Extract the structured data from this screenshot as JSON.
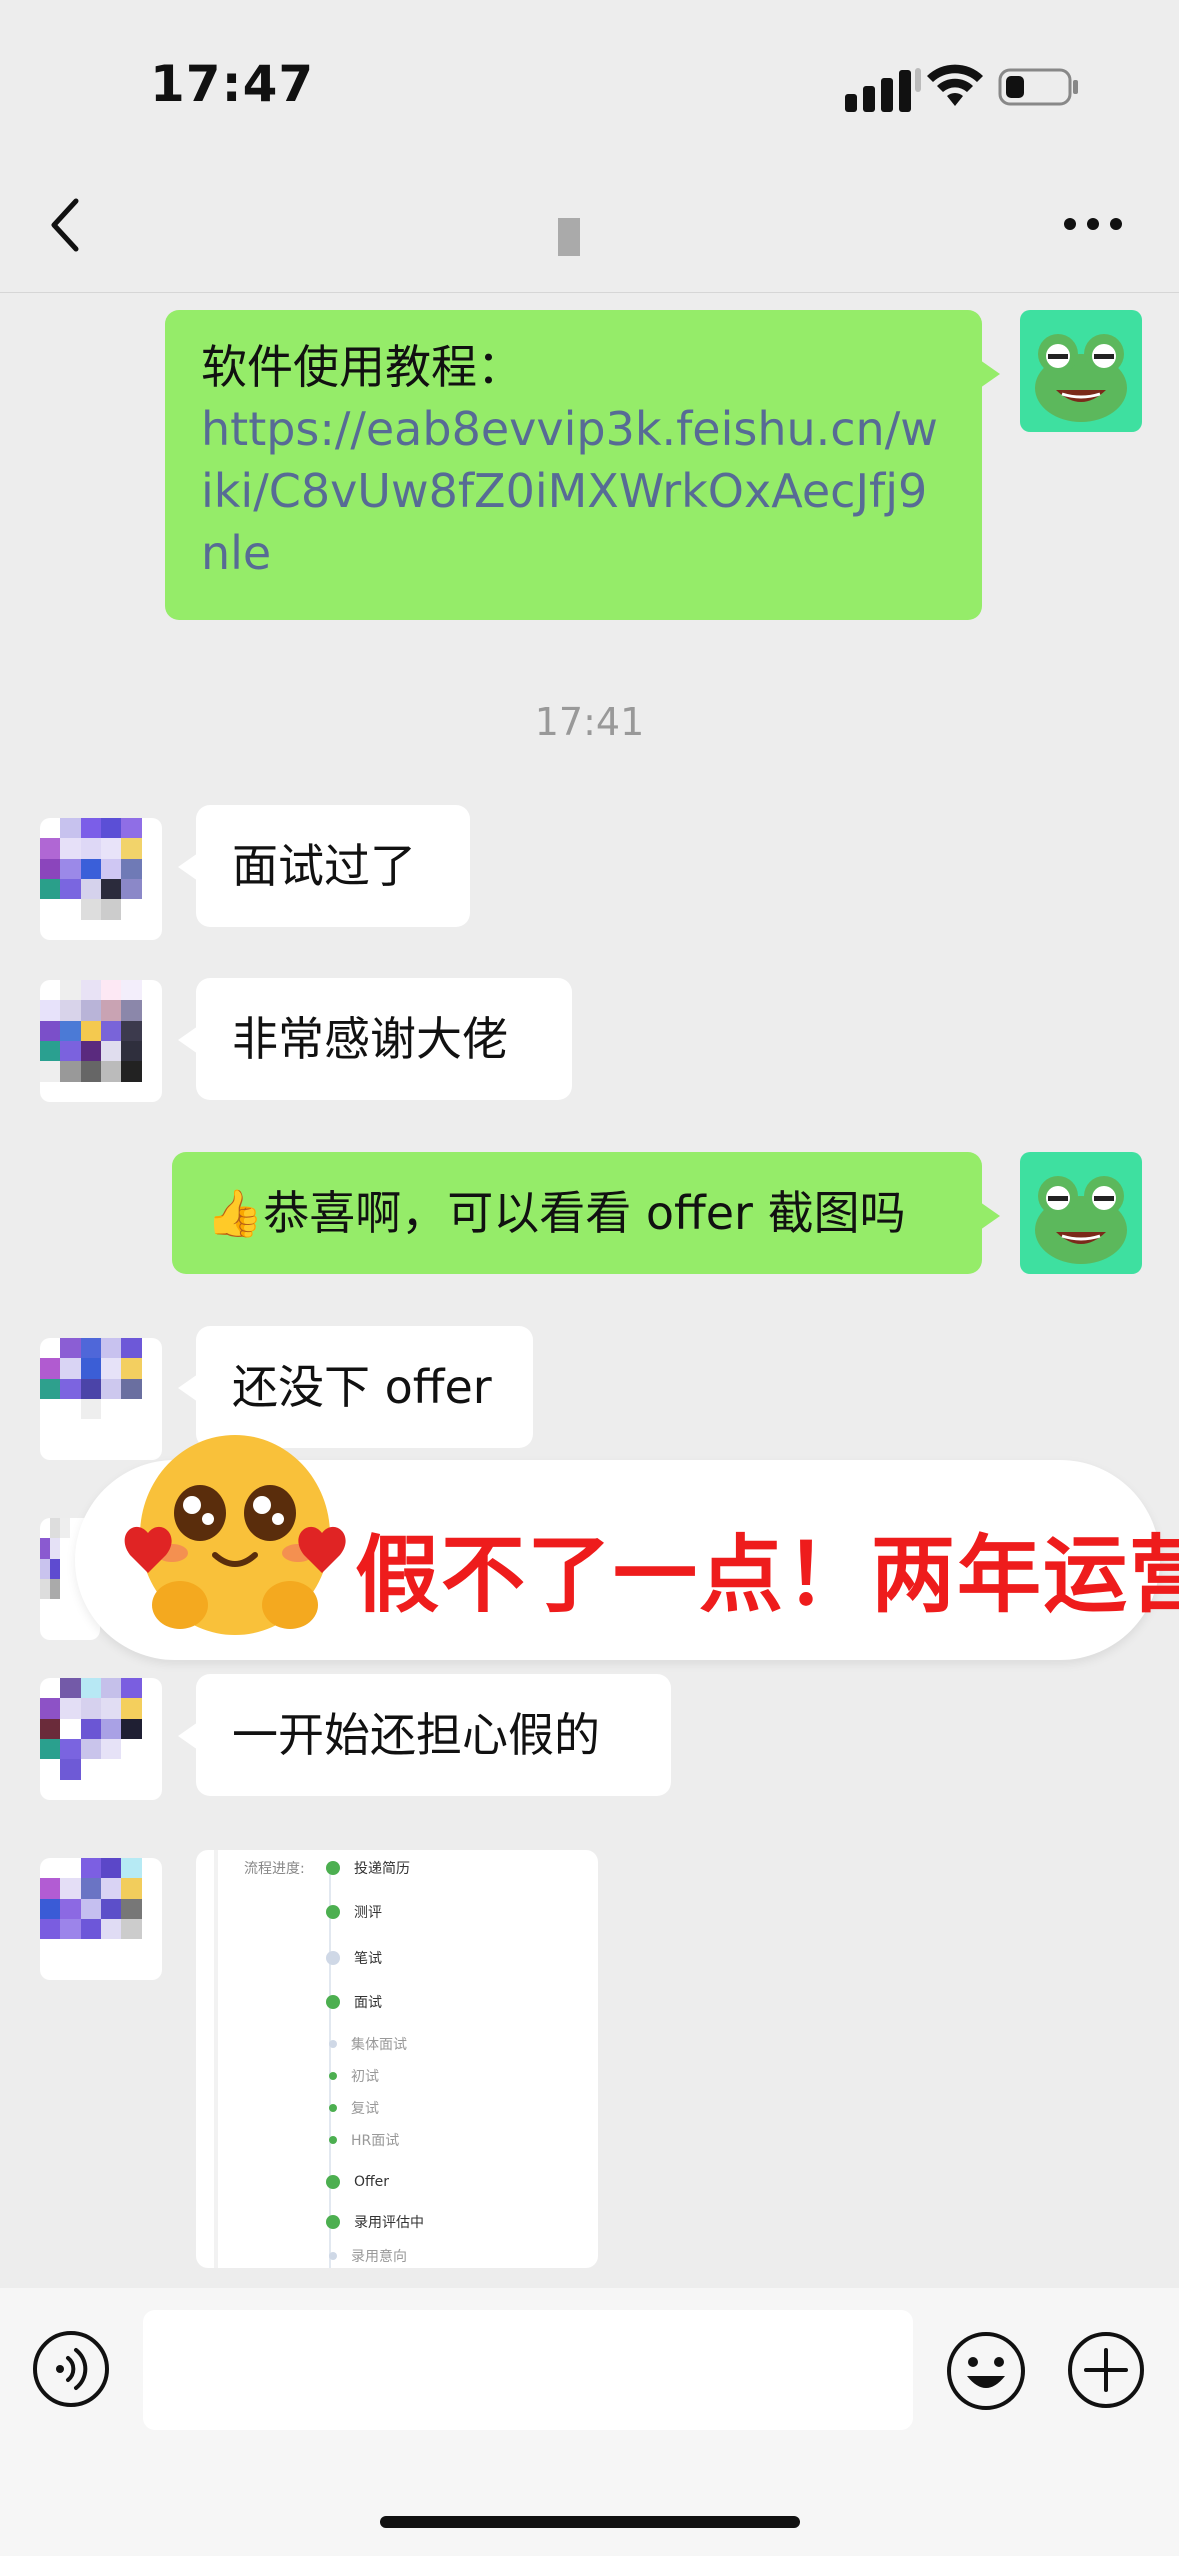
{
  "status_bar": {
    "time": "17:47"
  },
  "messages": {
    "m1_label": "软件使用教程：",
    "m1_link": "https://eab8evvip3k.feishu.cn/wiki/C8vUw8fZ0iMXWrkOxAecJfj9nle",
    "timestamp": "17:41",
    "m2": "面试过了",
    "m3": "非常感谢大佬",
    "m4_emoji": "👍",
    "m4": "恭喜啊，可以看看 offer 截图吗",
    "m5": "还没下 offer",
    "m7": "一开始还担心假的"
  },
  "overlay": {
    "text": "假不了一点！两年运营"
  },
  "screenshot_card": {
    "label": "流程进度:",
    "steps": [
      "投递简历",
      "测评",
      "笔试",
      "面试",
      "集体面试",
      "初试",
      "复试",
      "HR面试",
      "Offer",
      "录用评估中",
      "录用意向"
    ]
  },
  "colors": {
    "my_bubble": "#95ec69",
    "other_bubble": "#ffffff",
    "link": "#576b95",
    "overlay_text": "#ee1c1c",
    "frog_bg": "#3ee0a0"
  },
  "icons": [
    "back-icon",
    "more-icon",
    "voice-icon",
    "emoji-icon",
    "plus-icon",
    "signal-icon",
    "wifi-icon",
    "battery-icon"
  ]
}
